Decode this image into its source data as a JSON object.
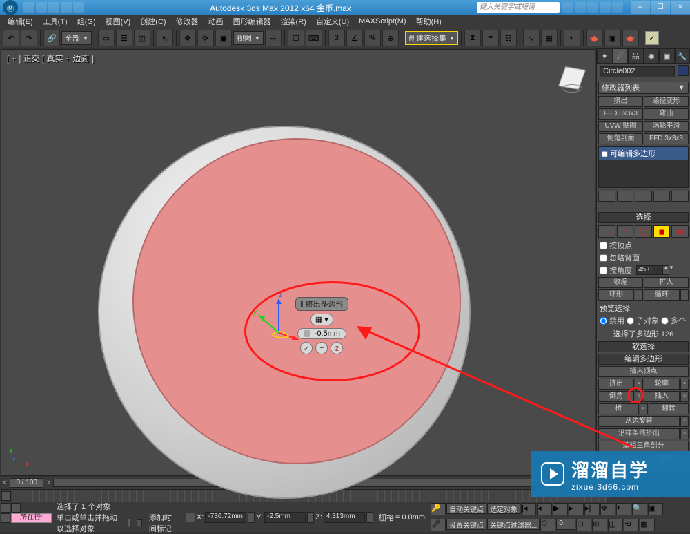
{
  "title": "Autodesk 3ds Max  2012 x64   金币.max",
  "search_placeholder": "键入关键字或短语",
  "win_min": "–",
  "win_max": "☐",
  "win_close": "×",
  "menu": [
    "编辑(E)",
    "工具(T)",
    "组(G)",
    "视图(V)",
    "创建(C)",
    "修改器",
    "动画",
    "图形编辑器",
    "渲染(R)",
    "自定义(U)",
    "MAXScript(M)",
    "帮助(H)"
  ],
  "toolbar": {
    "combo_all": "全部",
    "combo_view": "视图",
    "combo_selset": "创建选择集"
  },
  "viewport_label": "[ + ] 正交  [ 真实 + 边面 ]",
  "axes": {
    "x": "x",
    "y": "y",
    "z": "z"
  },
  "caddy": {
    "title": "‖ 挤出多边形",
    "value": "-0.5mm",
    "dropdown": "▦ ▾",
    "ok": "✓",
    "plus": "+",
    "cancel": "⊘"
  },
  "panel": {
    "object_name": "Circle002",
    "modlist": "修改器列表",
    "modbtns": [
      [
        "挤出",
        "路径变形"
      ],
      [
        "FFD 3x3x3",
        "弯曲"
      ],
      [
        "UVW 贴图",
        "涡轮平滑"
      ],
      [
        "倒角剖面",
        "FFD 3x3x3"
      ]
    ],
    "stack_item": "◼ 可编辑多边形",
    "sel_header": "选择",
    "sub_vertex": "∴",
    "sub_edge": "⁄",
    "sub_border": "◯",
    "sub_poly": "◼",
    "sub_elem": "◉",
    "chk_byvertex": "按顶点",
    "chk_ignoreback": "忽略背面",
    "chk_byangle": "按角度:",
    "angle_val": "45.0",
    "btn_shrink": "收缩",
    "btn_grow": "扩大",
    "btn_ring": "环形",
    "btn_loop": "循环",
    "preview_label": "预览选择",
    "rad_disable": "禁用",
    "rad_subobj": "子对象",
    "rad_multi": "多个",
    "sel_status": "选择了多边形 126",
    "softsel_header": "软选择",
    "editpoly_header": "编辑多边形",
    "insertvert": "插入顶点",
    "extrude": "挤出",
    "outline": "轮廓",
    "bevel": "倒角",
    "inset": "插入",
    "bridge": "桥",
    "flip": "翻转",
    "hinge": "从边旋转",
    "extspline": "沿样条线挤出",
    "edittri": "编辑三角剖分",
    "turn": "旋转"
  },
  "timeslider": {
    "value": "0 / 100"
  },
  "status": {
    "current": "所在行:",
    "line1": "选择了 1 个对象",
    "line2": "单击或单击并拖动以选择对象",
    "addtime": "添加时间标记",
    "x_lbl": "X:",
    "x": "-736.72mm",
    "y_lbl": "Y:",
    "y": "-2.5mm",
    "z_lbl": "Z:",
    "z": "4.313mm",
    "grid_lbl": "栅格",
    "grid": "= 0.0mm",
    "autokey": "自动关键点",
    "selmode": "选定对象",
    "setkey": "设置关键点",
    "keyfilters": "关键点过滤器..."
  },
  "watermark": {
    "brand": "溜溜自学",
    "url": "zixue.3d66.com"
  }
}
